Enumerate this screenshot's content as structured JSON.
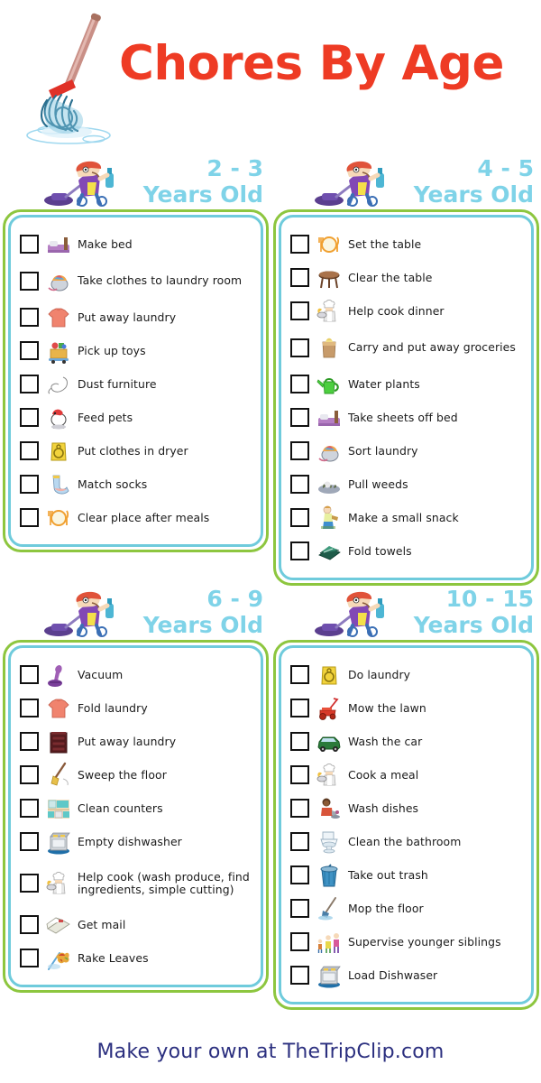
{
  "header": {
    "title": "Chores By Age",
    "title_color": "#ee3b24",
    "art": "mop-illustration"
  },
  "theme": {
    "card_outer_border": "#8dc63f",
    "card_inner_border": "#6fcbdc",
    "age_heading_color": "#7fd3e8",
    "footer_color": "#2b2f7f",
    "checkbox_border": "#111111"
  },
  "cards": [
    {
      "age": "2 - 3",
      "age_suffix": "Years Old",
      "art": "kid-with-vacuum-and-spray-bottle",
      "items": [
        {
          "label": "Make bed",
          "icon": "bed-icon"
        },
        {
          "label": "Take clothes to laundry room",
          "icon": "laundry-basket-icon"
        },
        {
          "label": "Put away laundry",
          "icon": "tshirt-icon"
        },
        {
          "label": "Pick up toys",
          "icon": "toy-box-icon"
        },
        {
          "label": "Dust furniture",
          "icon": "feather-duster-icon"
        },
        {
          "label": "Feed pets",
          "icon": "dog-bowl-icon"
        },
        {
          "label": "Put clothes in dryer",
          "icon": "dryer-icon"
        },
        {
          "label": "Match socks",
          "icon": "socks-icon"
        },
        {
          "label": "Clear place after meals",
          "icon": "place-setting-icon"
        }
      ]
    },
    {
      "age": "4 - 5",
      "age_suffix": "Years Old",
      "art": "kid-with-vacuum-and-spray-bottle",
      "items": [
        {
          "label": "Set the table",
          "icon": "place-setting-icon"
        },
        {
          "label": "Clear the table",
          "icon": "table-icon"
        },
        {
          "label": "Help cook dinner",
          "icon": "chef-icon"
        },
        {
          "label": "Carry and put away groceries",
          "icon": "grocery-bag-icon"
        },
        {
          "label": "Water plants",
          "icon": "watering-can-icon"
        },
        {
          "label": "Take sheets off bed",
          "icon": "bed-icon"
        },
        {
          "label": "Sort laundry",
          "icon": "laundry-basket-icon"
        },
        {
          "label": "Pull weeds",
          "icon": "weeds-icon"
        },
        {
          "label": "Make a small snack",
          "icon": "snack-kid-icon"
        },
        {
          "label": "Fold towels",
          "icon": "folded-towels-icon"
        }
      ]
    },
    {
      "age": "6 - 9",
      "age_suffix": "Years Old",
      "art": "kid-with-vacuum-and-spray-bottle",
      "items": [
        {
          "label": "Vacuum",
          "icon": "vacuum-icon"
        },
        {
          "label": "Fold laundry",
          "icon": "tshirt-icon"
        },
        {
          "label": "Put away laundry",
          "icon": "dresser-icon"
        },
        {
          "label": "Sweep the floor",
          "icon": "broom-icon"
        },
        {
          "label": "Clean counters",
          "icon": "counter-icon"
        },
        {
          "label": "Empty dishwasher",
          "icon": "dishwasher-icon"
        },
        {
          "label": "Help cook (wash produce, find ingredients, simple cutting)",
          "icon": "chef-icon"
        },
        {
          "label": "Get mail",
          "icon": "mail-icon"
        },
        {
          "label": "Rake Leaves",
          "icon": "rake-leaves-icon"
        }
      ]
    },
    {
      "age": "10 - 15",
      "age_suffix": "Years Old",
      "art": "kid-with-vacuum-and-spray-bottle",
      "items": [
        {
          "label": "Do laundry",
          "icon": "dryer-icon"
        },
        {
          "label": "Mow the lawn",
          "icon": "lawnmower-icon"
        },
        {
          "label": "Wash the car",
          "icon": "car-icon"
        },
        {
          "label": "Cook a meal",
          "icon": "chef-icon"
        },
        {
          "label": "Wash dishes",
          "icon": "washing-dishes-icon"
        },
        {
          "label": "Clean the bathroom",
          "icon": "toilet-icon"
        },
        {
          "label": "Take out trash",
          "icon": "trash-can-icon"
        },
        {
          "label": "Mop the floor",
          "icon": "mop-icon"
        },
        {
          "label": "Supervise younger siblings",
          "icon": "siblings-icon"
        },
        {
          "label": "Load Dishwaser",
          "icon": "dishwasher-icon"
        }
      ]
    }
  ],
  "footer": {
    "text": "Make your own at TheTripClip.com"
  }
}
